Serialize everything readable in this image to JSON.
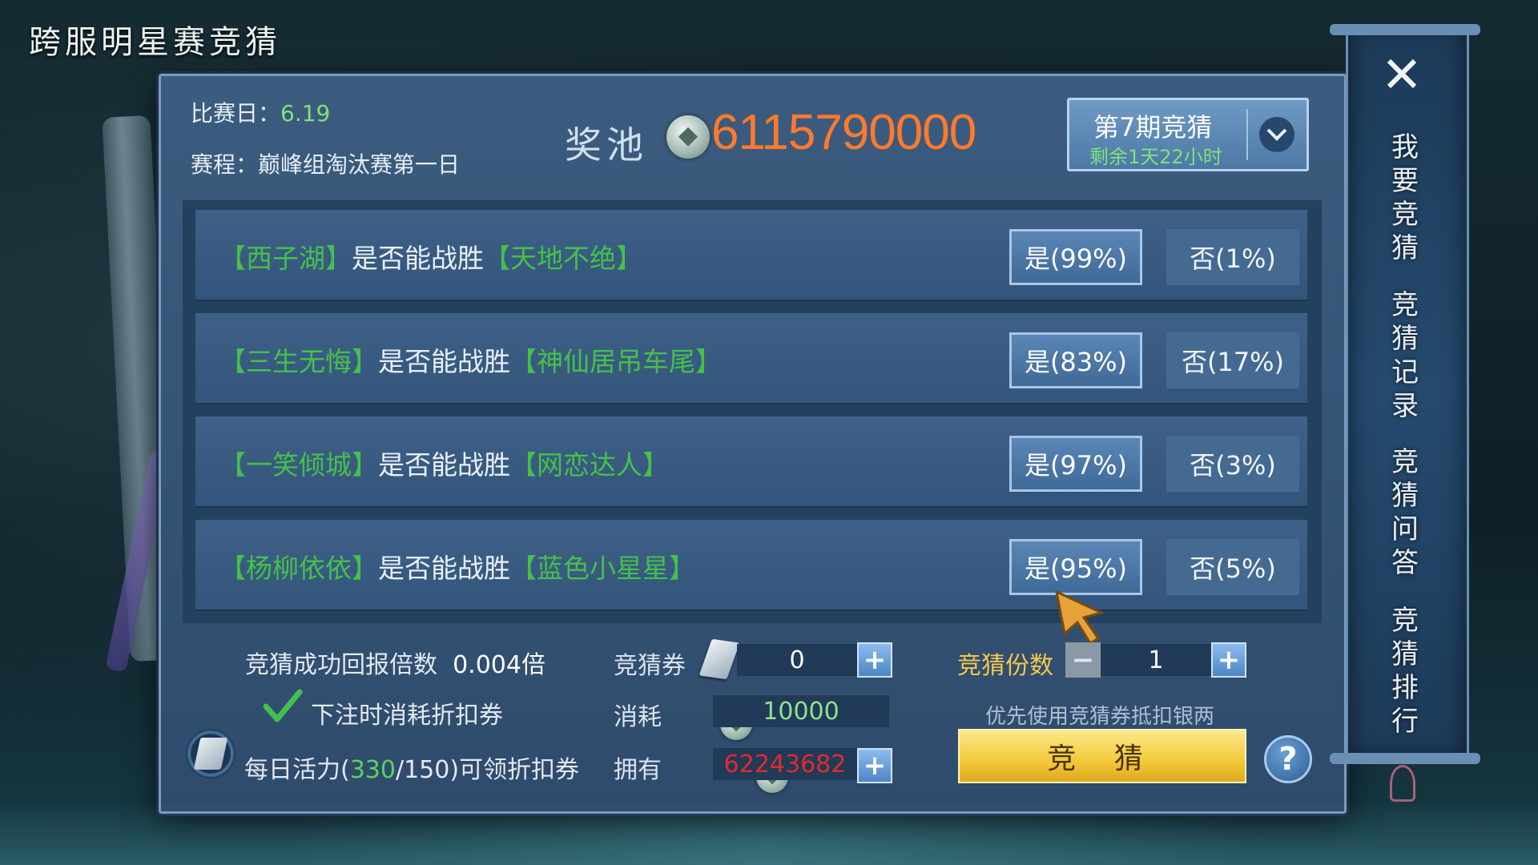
{
  "page_title": "跨服明星赛竞猜",
  "header": {
    "date_label": "比赛日：",
    "date_value": "6.19",
    "schedule_label": "赛程：",
    "schedule_value": "巅峰组淘汰赛第一日",
    "pool_label": "奖池",
    "pool_amount": "6115790000",
    "period_title": "第7期竞猜",
    "period_remaining": "剩余1天22小时"
  },
  "matches": [
    {
      "team_a": "【西子湖】",
      "text": "是否能战胜",
      "team_b": "【天地不绝】",
      "yes": "是(99%)",
      "no": "否(1%)"
    },
    {
      "team_a": "【三生无悔】",
      "text": "是否能战胜",
      "team_b": "【神仙居吊车尾】",
      "yes": "是(83%)",
      "no": "否(17%)"
    },
    {
      "team_a": "【一笑倾城】",
      "text": "是否能战胜",
      "team_b": "【网恋达人】",
      "yes": "是(97%)",
      "no": "否(3%)"
    },
    {
      "team_a": "【杨柳依依】",
      "text": "是否能战胜",
      "team_b": "【蓝色小星星】",
      "yes": "是(95%)",
      "no": "否(5%)"
    }
  ],
  "bottom": {
    "ratio_label": "竞猜成功回报倍数",
    "ratio_value": "0.004倍",
    "discount_label": "下注时消耗折扣券",
    "daily_prefix": "每日活力(",
    "daily_current": "330",
    "daily_suffix": "/150)可领折扣券",
    "ticket_label": "竞猜券",
    "ticket_value": "0",
    "cost_label": "消耗",
    "cost_value": "10000",
    "own_label": "拥有",
    "own_value": "62243682",
    "share_label": "竞猜份数",
    "share_value": "1",
    "hint": "优先使用竞猜券抵扣银两",
    "bet_button": "竞 猜",
    "help": "?"
  },
  "side_menu": {
    "items": [
      "我要竞猜",
      "竞猜记录",
      "竞猜问答",
      "竞猜排行"
    ]
  },
  "icons": {
    "close": "close-icon",
    "chevron": "chevron-down-icon",
    "coin": "silver-coin-icon",
    "ticket": "ticket-icon",
    "check": "checkmark-icon"
  },
  "colors": {
    "team_green": "#45c14a",
    "pool_orange": "#ff7a2a",
    "own_red": "#e02b2b",
    "gold_button": "#f3c93a"
  }
}
